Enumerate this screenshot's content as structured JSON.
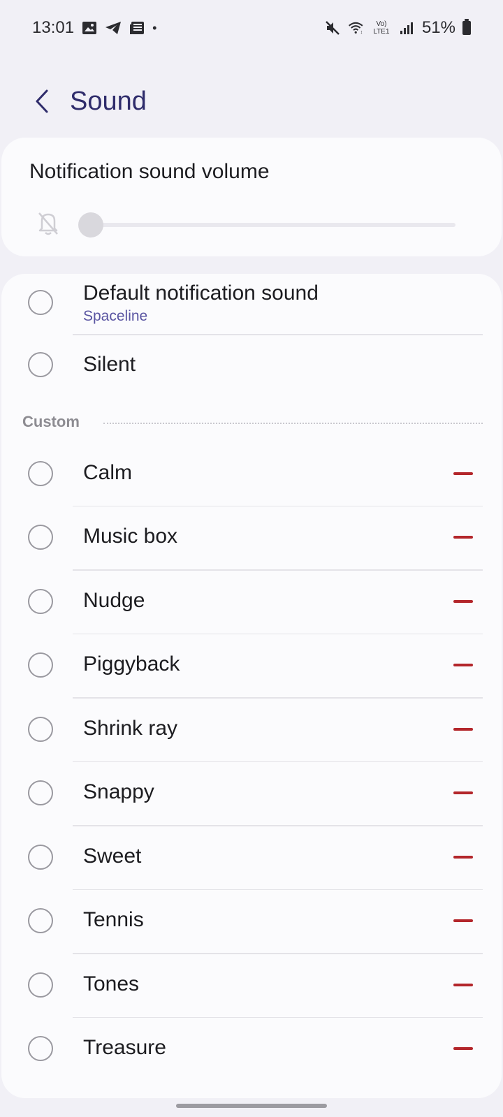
{
  "status_bar": {
    "time": "13:01",
    "left_icons": [
      "gallery-icon",
      "telegram-icon",
      "news-icon"
    ],
    "dot": "•",
    "network_label": "Vo) LTE1",
    "battery": "51%"
  },
  "header": {
    "title": "Sound"
  },
  "volume": {
    "title": "Notification sound volume",
    "level": 0
  },
  "sounds": {
    "default": {
      "label": "Default notification sound",
      "sub": "Spaceline"
    },
    "silent": {
      "label": "Silent"
    },
    "custom_header": "Custom",
    "custom": [
      {
        "label": "Calm"
      },
      {
        "label": "Music box"
      },
      {
        "label": "Nudge"
      },
      {
        "label": "Piggyback"
      },
      {
        "label": "Shrink ray"
      },
      {
        "label": "Snappy"
      },
      {
        "label": "Sweet"
      },
      {
        "label": "Tennis"
      },
      {
        "label": "Tones"
      },
      {
        "label": "Treasure"
      }
    ]
  },
  "colors": {
    "accent": "#2f2c6b",
    "subtext": "#5a55a2",
    "remove": "#b3262b",
    "background": "#f1f0f6",
    "card": "#fbfbfd"
  }
}
